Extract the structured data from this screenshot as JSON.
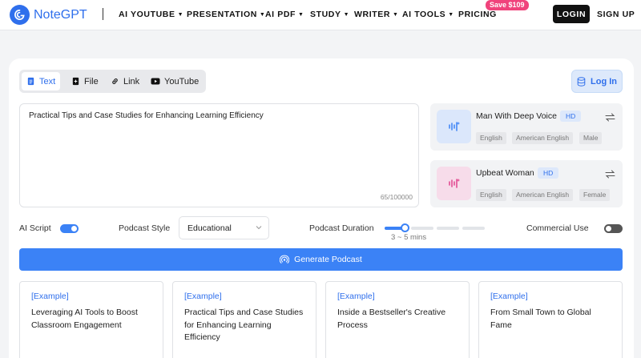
{
  "brand": {
    "name": "NoteGPT",
    "color": "#2f6fec"
  },
  "nav": {
    "menu": [
      {
        "label": "AI YOUTUBE",
        "has_dropdown": true
      },
      {
        "label": "PRESENTATION",
        "has_dropdown": true
      },
      {
        "label": "AI PDF",
        "has_dropdown": true
      },
      {
        "label": "STUDY",
        "has_dropdown": true
      },
      {
        "label": "WRITER",
        "has_dropdown": true
      },
      {
        "label": "AI TOOLS",
        "has_dropdown": true
      },
      {
        "label": "PRICING",
        "has_dropdown": false
      }
    ],
    "promo_badge": "Save $109",
    "login_label": "LOGIN",
    "signup_label": "SIGN UP"
  },
  "tabs": [
    {
      "label": "Text",
      "icon": "document-icon",
      "active": true
    },
    {
      "label": "File",
      "icon": "file-plus-icon",
      "active": false
    },
    {
      "label": "Link",
      "icon": "link-icon",
      "active": false
    },
    {
      "label": "YouTube",
      "icon": "youtube-icon",
      "active": false
    }
  ],
  "account": {
    "login_label": "Log In"
  },
  "input": {
    "value": "Practical Tips and Case Studies for Enhancing Learning Efficiency",
    "char_count": "65/100000"
  },
  "voices": [
    {
      "name": "Man With Deep Voice",
      "quality": "HD",
      "tags": [
        "English",
        "American English",
        "Male"
      ],
      "accent": "#3b82f6"
    },
    {
      "name": "Upbeat Woman",
      "quality": "HD",
      "tags": [
        "English",
        "American English",
        "Female"
      ],
      "accent": "#e0438c"
    }
  ],
  "options": {
    "ai_script_label": "AI Script",
    "ai_script_on": true,
    "style_label": "Podcast Style",
    "style_value": "Educational",
    "duration_label": "Podcast Duration",
    "duration_value": "3 ~ 5 mins",
    "duration_level": 0.2,
    "commercial_label": "Commercial Use",
    "commercial_on": false
  },
  "generate_label": "Generate Podcast",
  "examples": [
    {
      "tag": "[Example]",
      "text": "Leveraging AI Tools to Boost Classroom Engagement"
    },
    {
      "tag": "[Example]",
      "text": "Practical Tips and Case Studies for Enhancing Learning Efficiency"
    },
    {
      "tag": "[Example]",
      "text": "Inside a Bestseller's Creative Process"
    },
    {
      "tag": "[Example]",
      "text": "From Small Town to Global Fame"
    }
  ]
}
